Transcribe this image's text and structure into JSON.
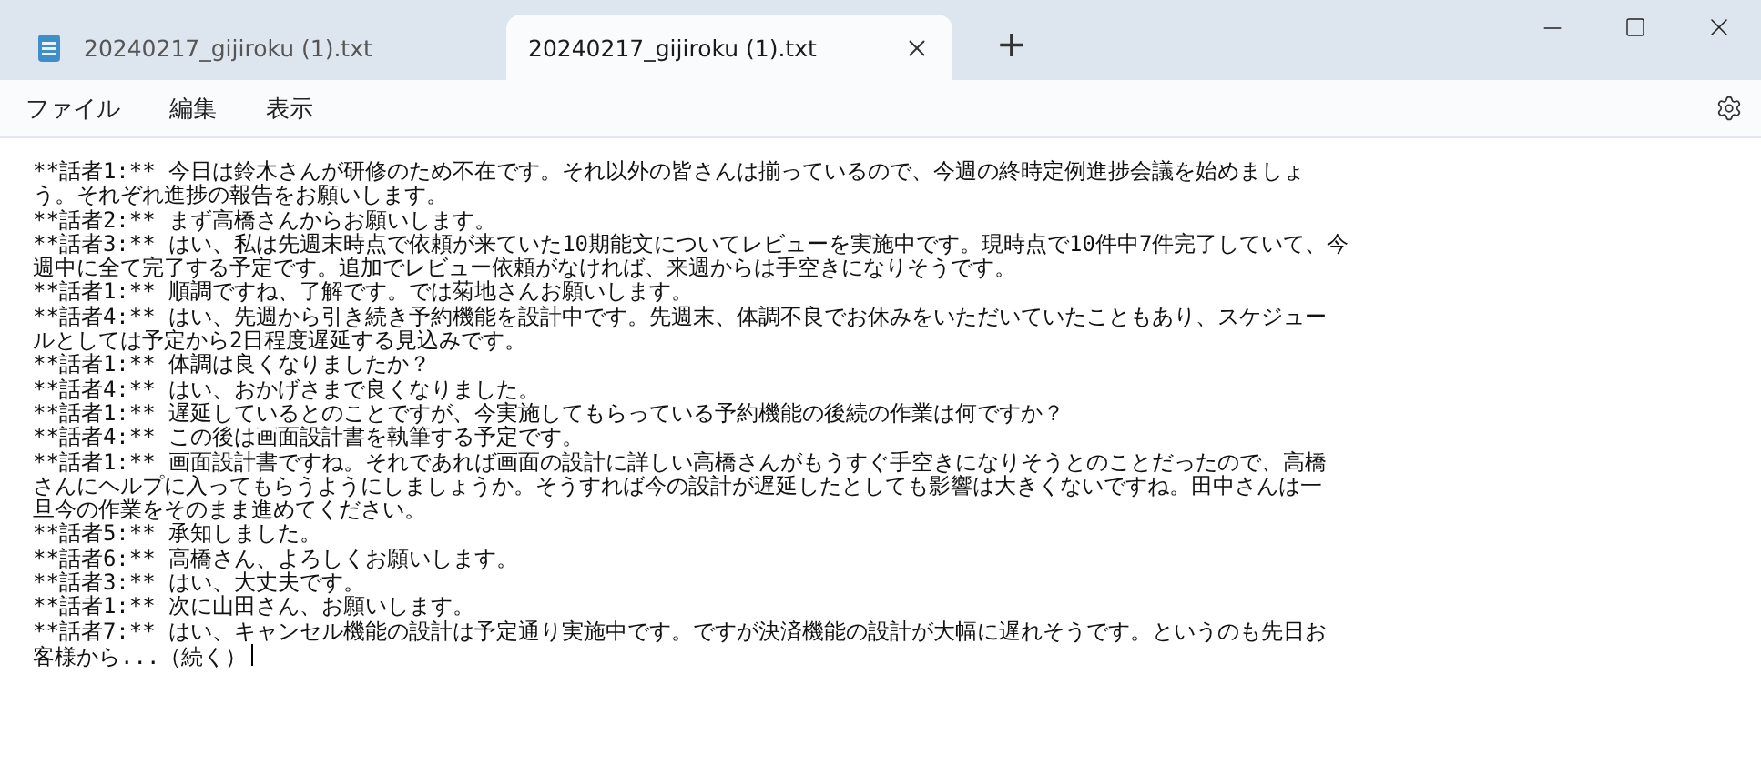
{
  "tabs": [
    {
      "title": "20240217_gijiroku (1).txt",
      "selected": false
    },
    {
      "title": "20240217_gijiroku (1).txt",
      "selected": true
    }
  ],
  "new_tab": "+",
  "menu": [
    "ファイル",
    "編集",
    "表示"
  ],
  "lines": [
    "**話者1:** 今日は鈴木さんが研修のため不在です。それ以外の皆さんは揃っているので、今週の終時定例進捗会議を始めましょ",
    "う。それぞれ進捗の報告をお願いします。",
    "**話者2:** まず高橋さんからお願いします。",
    "**話者3:** はい、私は先週末時点で依頼が来ていた10期能文についてレビューを実施中です。現時点で10件中7件完了していて、今",
    "週中に全て完了する予定です。追加でレビュー依頼がなければ、来週からは手空きになりそうです。",
    "**話者1:** 順調ですね、了解です。では菊地さんお願いします。",
    "**話者4:** はい、先週から引き続き予約機能を設計中です。先週末、体調不良でお休みをいただいていたこともあり、スケジュー",
    "ルとしては予定から2日程度遅延する見込みです。",
    "**話者1:** 体調は良くなりましたか？",
    "**話者4:** はい、おかげさまで良くなりました。",
    "**話者1:** 遅延しているとのことですが、今実施してもらっている予約機能の後続の作業は何ですか？",
    "**話者4:** この後は画面設計書を執筆する予定です。",
    "**話者1:** 画面設計書ですね。それであれば画面の設計に詳しい高橋さんがもうすぐ手空きになりそうとのことだったので、高橋",
    "さんにヘルプに入ってもらうようにしましょうか。そうすれば今の設計が遅延したとしても影響は大きくないですね。田中さんは一",
    "旦今の作業をそのまま進めてください。",
    "**話者5:** 承知しました。",
    "**話者6:** 高橋さん、よろしくお願いします。",
    "**話者3:** はい、大丈夫です。",
    "**話者1:** 次に山田さん、お願いします。",
    "**話者7:** はい、キャンセル機能の設計は予定通り実施中です。ですが決済機能の設計が大幅に遅れそうです。というのも先日お",
    "客様から...（続く）"
  ]
}
